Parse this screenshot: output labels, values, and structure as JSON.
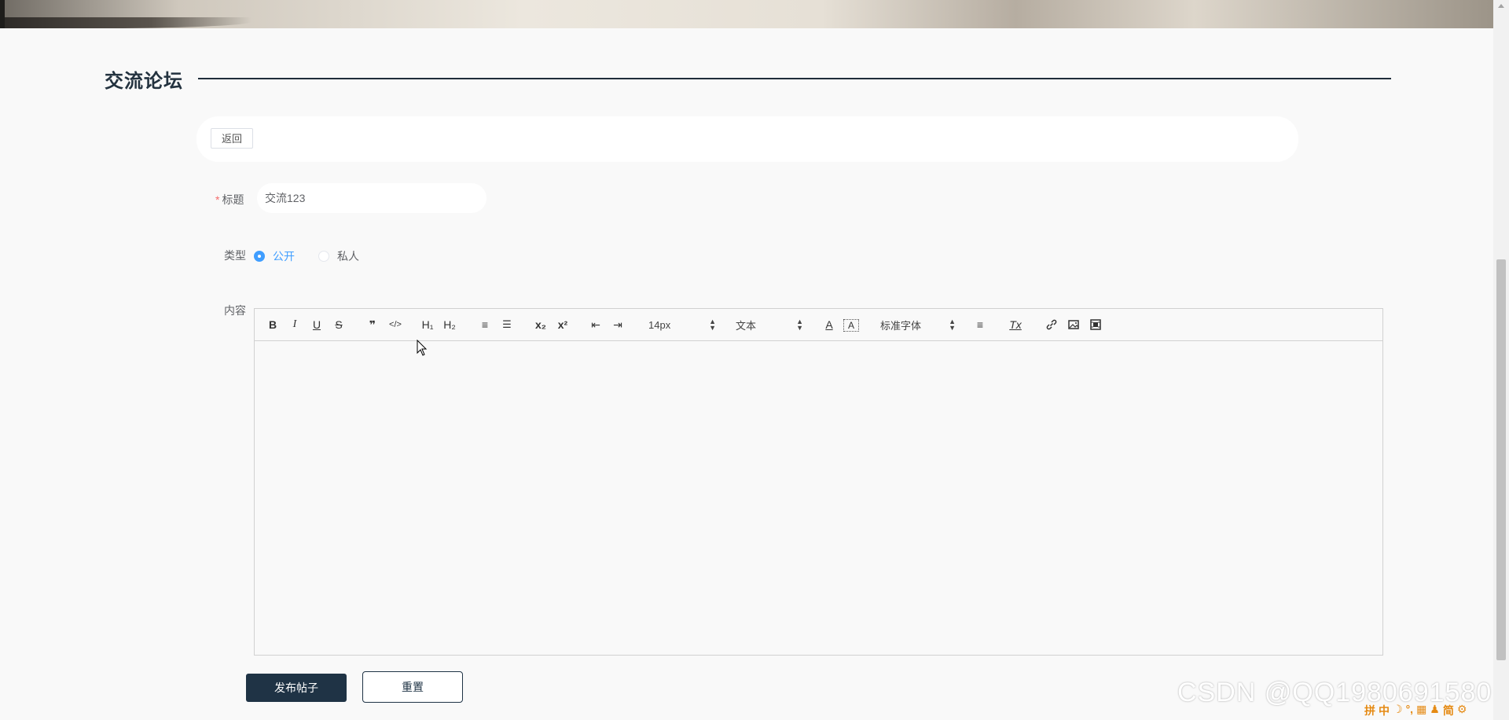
{
  "section": {
    "title": "交流论坛"
  },
  "actions": {
    "back_label": "返回",
    "publish_label": "发布帖子",
    "reset_label": "重置"
  },
  "form": {
    "title_label": "标题",
    "title_required_mark": "*",
    "title_value": "交流123",
    "type_label": "类型",
    "type_options": [
      {
        "label": "公开",
        "selected": true
      },
      {
        "label": "私人",
        "selected": false
      }
    ],
    "content_label": "内容"
  },
  "editor": {
    "toolbar": {
      "bold": "B",
      "italic": "I",
      "underline": "U",
      "strike": "S",
      "quote": "❞",
      "code": "</>",
      "h1": "H₁",
      "h2": "H₂",
      "ordered_list": "≡",
      "bullet_list": "☰",
      "subscript": "x₂",
      "superscript": "x²",
      "outdent": "⇤",
      "indent": "⇥",
      "size_value": "14px",
      "header_value": "文本",
      "font_color": "A",
      "background_color": "A",
      "font_value": "标准字体",
      "align": "≡",
      "clean": "Tx"
    }
  },
  "overlay": {
    "watermark": "CSDN @QQ1980691580",
    "ime_icons": [
      "拼",
      "中",
      "☽",
      "°,",
      "▦",
      "♟",
      "简",
      "⚙"
    ]
  },
  "colors": {
    "accent": "#409eff",
    "primary_dark": "#1f3345",
    "required": "#f56c6c"
  }
}
